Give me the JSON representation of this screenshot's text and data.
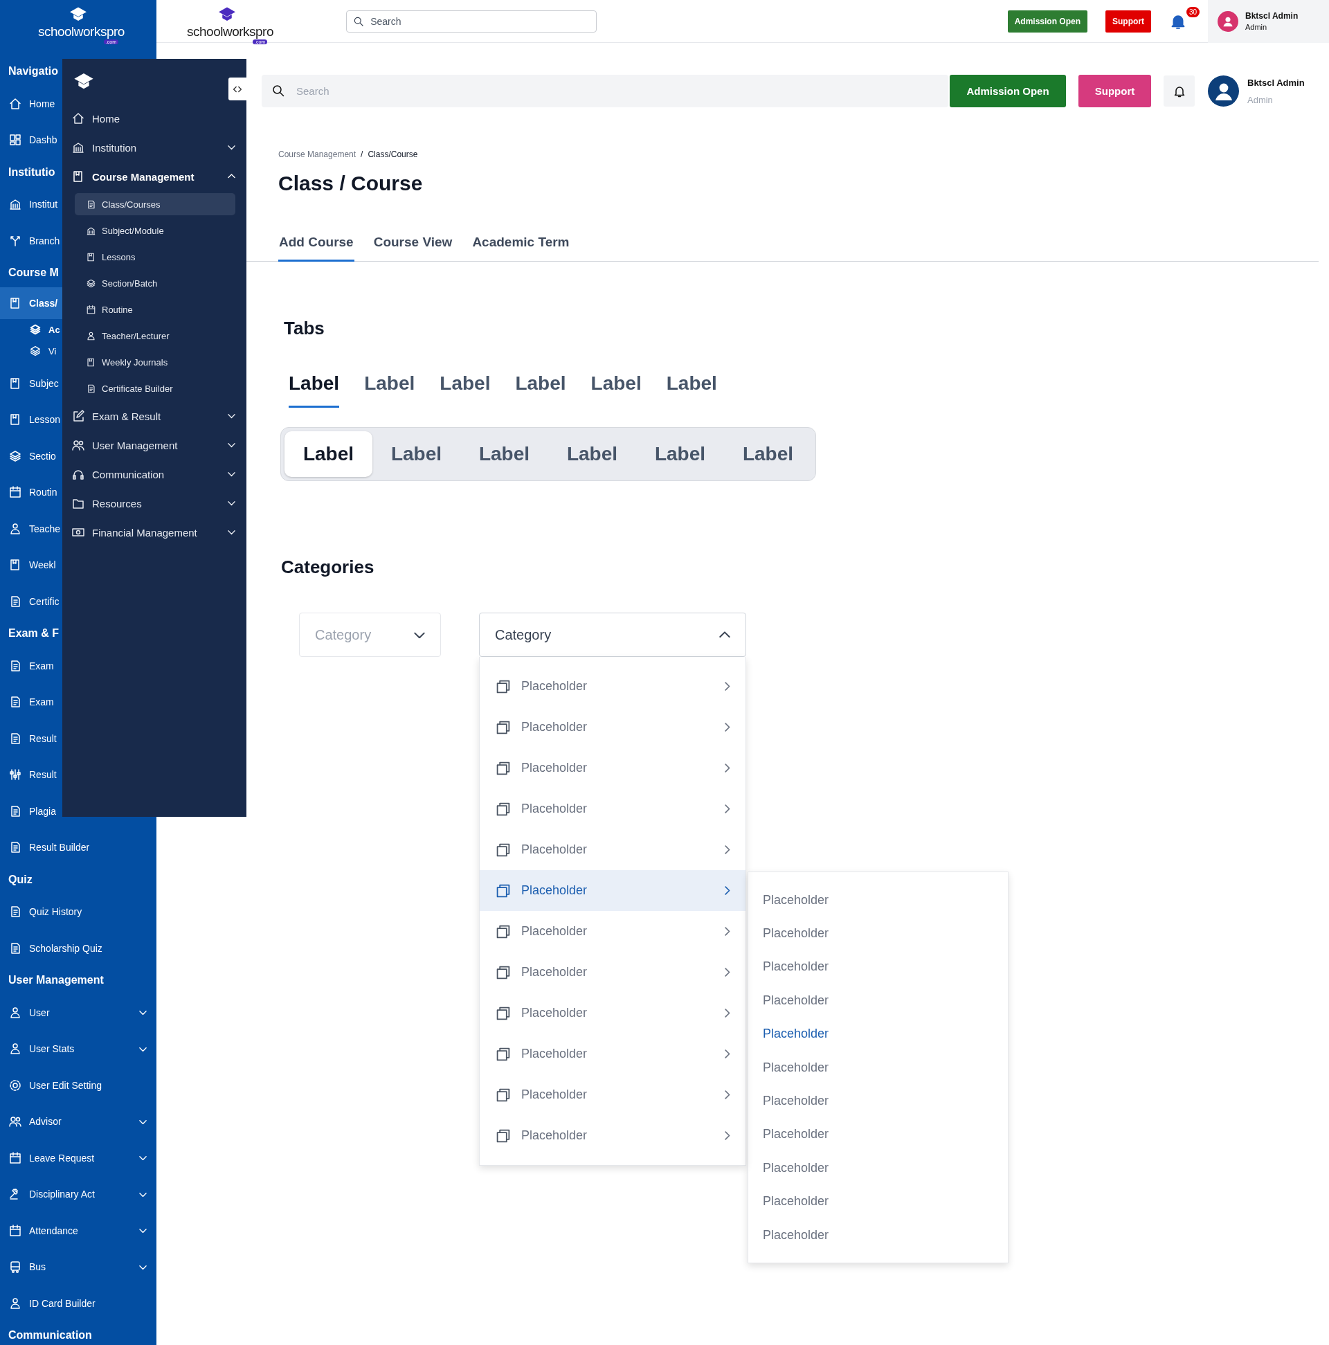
{
  "back_page": {
    "sidebar_logo": {
      "text": "schoolworkspro",
      "suffix": ".com"
    },
    "header_logo": {
      "text": "schoolworkspro",
      "suffix": ".com"
    },
    "search": {
      "placeholder": "Search"
    },
    "buttons": [
      {
        "label": "Admission Open",
        "kind": "admission"
      },
      {
        "label": "Support",
        "kind": "support"
      }
    ],
    "notification_count": "30",
    "user": {
      "name": "Bktscl Admin",
      "role": "Admin"
    },
    "sidebar": [
      {
        "kind": "heading",
        "label": "Navigatio"
      },
      {
        "kind": "link",
        "label": "Home",
        "selected": false
      },
      {
        "kind": "link",
        "label": "Dashb",
        "selected": false
      },
      {
        "kind": "heading",
        "label": "Institutio"
      },
      {
        "kind": "link",
        "label": "Institut",
        "selected": false
      },
      {
        "kind": "link",
        "label": "Branch",
        "selected": false
      },
      {
        "kind": "heading",
        "label": "Course M"
      },
      {
        "kind": "link",
        "label": "Class/",
        "selected": true,
        "children": [
          {
            "label": "Ac",
            "selected": true
          },
          {
            "label": "Vi",
            "selected": false
          }
        ]
      },
      {
        "kind": "link",
        "label": "Subjec",
        "selected": false
      },
      {
        "kind": "link",
        "label": "Lesson",
        "selected": false
      },
      {
        "kind": "link",
        "label": "Sectio",
        "selected": false
      },
      {
        "kind": "link",
        "label": "Routin",
        "selected": false
      },
      {
        "kind": "link",
        "label": "Teache",
        "selected": false
      },
      {
        "kind": "link",
        "label": "Weekl",
        "selected": false
      },
      {
        "kind": "link",
        "label": "Certific",
        "selected": false
      },
      {
        "kind": "heading",
        "label": "Exam & F"
      },
      {
        "kind": "link",
        "label": "Exam",
        "selected": false
      },
      {
        "kind": "link",
        "label": "Exam",
        "selected": false
      },
      {
        "kind": "link",
        "label": "Result",
        "selected": false
      },
      {
        "kind": "link",
        "label": "Result",
        "selected": false
      },
      {
        "kind": "link",
        "label": "Plagia",
        "selected": false
      },
      {
        "kind": "link",
        "label": "Result Builder",
        "selected": false
      },
      {
        "kind": "heading",
        "label": "Quiz"
      },
      {
        "kind": "link",
        "label": "Quiz History",
        "selected": false
      },
      {
        "kind": "link",
        "label": "Scholarship Quiz",
        "selected": false
      },
      {
        "kind": "heading",
        "label": "User Management"
      },
      {
        "kind": "group",
        "label": "User",
        "selected": false,
        "expanded": false
      },
      {
        "kind": "group",
        "label": "User Stats",
        "selected": false,
        "expanded": false
      },
      {
        "kind": "link",
        "label": "User Edit Setting",
        "selected": false
      },
      {
        "kind": "group",
        "label": "Advisor",
        "selected": false,
        "expanded": false
      },
      {
        "kind": "group",
        "label": "Leave Request",
        "selected": false,
        "expanded": false
      },
      {
        "kind": "group",
        "label": "Disciplinary Act",
        "selected": false,
        "expanded": false
      },
      {
        "kind": "group",
        "label": "Attendance",
        "selected": false,
        "expanded": false
      },
      {
        "kind": "group",
        "label": "Bus",
        "selected": false,
        "expanded": false
      },
      {
        "kind": "link",
        "label": "ID Card Builder",
        "selected": false
      },
      {
        "kind": "heading",
        "label": "Communication"
      }
    ]
  },
  "front_app": {
    "sidebar": [
      {
        "kind": "link",
        "label": "Home",
        "selected": false
      },
      {
        "kind": "group",
        "label": "Institution",
        "expanded": false
      },
      {
        "kind": "group",
        "label": "Course Management",
        "expanded": true,
        "children": [
          {
            "label": "Class/Courses",
            "selected": true
          },
          {
            "label": "Subject/Module",
            "selected": false
          },
          {
            "label": "Lessons",
            "selected": false
          },
          {
            "label": "Section/Batch",
            "selected": false
          },
          {
            "label": "Routine",
            "selected": false
          },
          {
            "label": "Teacher/Lecturer",
            "selected": false
          },
          {
            "label": "Weekly Journals",
            "selected": false
          },
          {
            "label": "Certificate Builder",
            "selected": false
          }
        ]
      },
      {
        "kind": "group",
        "label": "Exam & Result",
        "expanded": false
      },
      {
        "kind": "group",
        "label": "User Management",
        "expanded": false
      },
      {
        "kind": "group",
        "label": "Communication",
        "expanded": false
      },
      {
        "kind": "group",
        "label": "Resources",
        "expanded": false
      },
      {
        "kind": "group",
        "label": "Financial Management",
        "expanded": false
      }
    ],
    "header": {
      "search": {
        "placeholder": "Search"
      },
      "buttons": [
        {
          "label": "Admission Open",
          "kind": "admission"
        },
        {
          "label": "Support",
          "kind": "support"
        }
      ],
      "user": {
        "name": "Bktscl Admin",
        "role": "Admin"
      }
    },
    "breadcrumb_separator": "/",
    "breadcrumb": [
      {
        "label": "Course Management",
        "current": false
      },
      {
        "label": "Class/Course",
        "current": true
      }
    ],
    "title": "Class / Course",
    "page_tabs": [
      {
        "label": "Add Course",
        "selected": true
      },
      {
        "label": "Course View",
        "selected": false
      },
      {
        "label": "Academic Term",
        "selected": false
      }
    ],
    "tabs_section": {
      "heading": "Tabs",
      "underline_tabs": [
        {
          "label": "Label",
          "selected": true
        },
        {
          "label": "Label",
          "selected": false
        },
        {
          "label": "Label",
          "selected": false
        },
        {
          "label": "Label",
          "selected": false
        },
        {
          "label": "Label",
          "selected": false
        },
        {
          "label": "Label",
          "selected": false
        }
      ],
      "segmented_tabs": [
        {
          "label": "Label",
          "selected": true
        },
        {
          "label": "Label",
          "selected": false
        },
        {
          "label": "Label",
          "selected": false
        },
        {
          "label": "Label",
          "selected": false
        },
        {
          "label": "Label",
          "selected": false
        },
        {
          "label": "Label",
          "selected": false
        }
      ]
    },
    "categories_section": {
      "heading": "Categories",
      "dropdowns": [
        {
          "placeholder": "Category",
          "expanded": false
        },
        {
          "placeholder": "Category",
          "expanded": true,
          "options": [
            {
              "label": "Placeholder",
              "selected": false
            },
            {
              "label": "Placeholder",
              "selected": false
            },
            {
              "label": "Placeholder",
              "selected": false
            },
            {
              "label": "Placeholder",
              "selected": false
            },
            {
              "label": "Placeholder",
              "selected": false
            },
            {
              "label": "Placeholder",
              "selected": true
            },
            {
              "label": "Placeholder",
              "selected": false
            },
            {
              "label": "Placeholder",
              "selected": false
            },
            {
              "label": "Placeholder",
              "selected": false
            },
            {
              "label": "Placeholder",
              "selected": false
            },
            {
              "label": "Placeholder",
              "selected": false
            },
            {
              "label": "Placeholder",
              "selected": false
            }
          ]
        }
      ],
      "submenu": [
        {
          "label": "Placeholder",
          "selected": false
        },
        {
          "label": "Placeholder",
          "selected": false
        },
        {
          "label": "Placeholder",
          "selected": false
        },
        {
          "label": "Placeholder",
          "selected": false
        },
        {
          "label": "Placeholder",
          "selected": true
        },
        {
          "label": "Placeholder",
          "selected": false
        },
        {
          "label": "Placeholder",
          "selected": false
        },
        {
          "label": "Placeholder",
          "selected": false
        },
        {
          "label": "Placeholder",
          "selected": false
        },
        {
          "label": "Placeholder",
          "selected": false
        },
        {
          "label": "Placeholder",
          "selected": false
        }
      ]
    }
  }
}
